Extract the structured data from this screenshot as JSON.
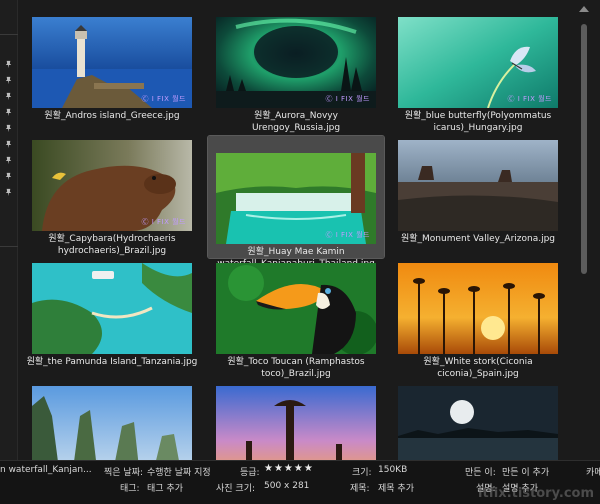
{
  "thumbnails": [
    {
      "caption": "원활_Andros island_Greece.jpg",
      "watermark": "Ⓒ I FIX 월드"
    },
    {
      "caption": "원활_Aurora_Novyy Urengoy_Russia.jpg",
      "watermark": "Ⓒ I FIX 월드"
    },
    {
      "caption": "원활_blue butterfly(Polyommatus\nicarus)_Hungary.jpg",
      "watermark": "Ⓒ I FIX 월드"
    },
    {
      "caption": "원활_Capybara(Hydrochaeris\nhydrochaeris)_Brazil.jpg",
      "watermark": "Ⓒ I FIX 월드"
    },
    {
      "caption": "원활_Huay Mae Kamin\nwaterfall_Kanjanaburi_Thailand.jpg",
      "watermark": "Ⓒ I FIX 월드"
    },
    {
      "caption": "원활_Monument Valley_Arizona.jpg",
      "watermark": ""
    },
    {
      "caption": "원활_the Pamunda Island_Tanzania.jpg",
      "watermark": ""
    },
    {
      "caption": "원활_Toco Toucan (Ramphastos\ntoco)_Brazil.jpg",
      "watermark": ""
    },
    {
      "caption": "원활_White stork(Ciconia\nciconia)_Spain.jpg",
      "watermark": ""
    }
  ],
  "status": {
    "filename_truncated": "n waterfall_Kanjan...",
    "date_taken_label": "찍은 날짜:",
    "date_taken_value": "수행한 날짜 지정",
    "tags_label": "태그:",
    "tags_value": "태그 추가",
    "rating_label": "등급:",
    "rating_stars": "★★★★★",
    "dimensions_label": "사진 크기:",
    "dimensions_value": "500 x 281",
    "size_label": "크기:",
    "size_value": "150KB",
    "title_label": "제목:",
    "title_value": "제목 추가",
    "author_label": "만든 이:",
    "author_value": "만든 이 추가",
    "description_label": "설명:",
    "description_value": "설명 추가",
    "camera_label": "카메"
  },
  "site_watermark": "itfix.tistory.com"
}
